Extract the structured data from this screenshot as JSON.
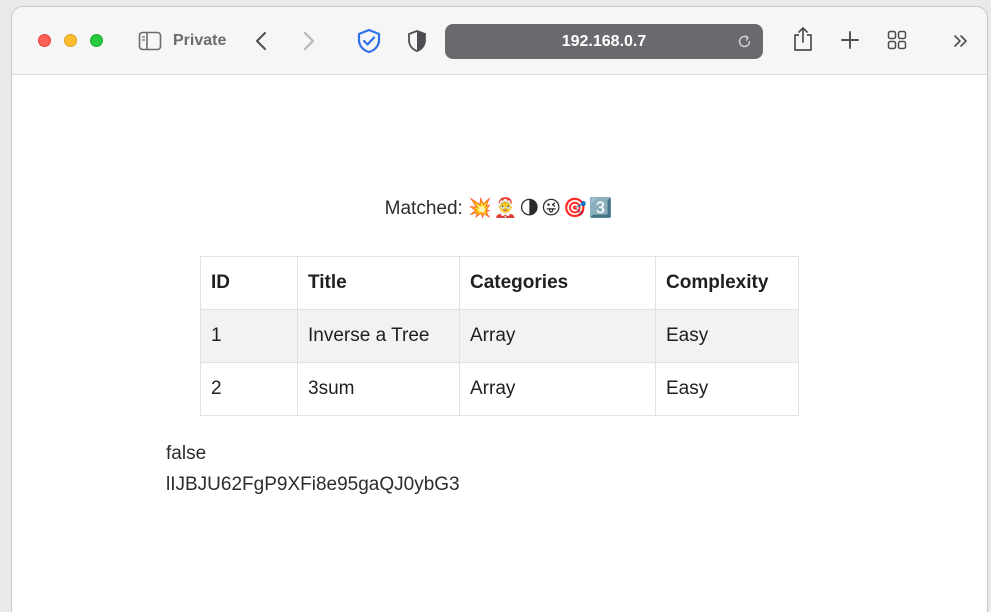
{
  "browser": {
    "private_label": "Private",
    "address": "192.168.0.7",
    "icons": [
      "sidebar-icon",
      "chevron-left-icon",
      "chevron-right-icon",
      "shield-check-icon",
      "privacy-shield-icon",
      "reload-icon",
      "share-icon",
      "plus-icon",
      "tab-grid-icon",
      "chevron-double-right-icon"
    ]
  },
  "page": {
    "matched_label": "Matched:",
    "matched_emojis": "💥🤶🌗😜🎯3️⃣",
    "table": {
      "headers": [
        "ID",
        "Title",
        "Categories",
        "Complexity"
      ],
      "rows": [
        [
          "1",
          "Inverse a Tree",
          "Array",
          "Easy"
        ],
        [
          "2",
          "3sum",
          "Array",
          "Easy"
        ]
      ]
    },
    "bool_value": "false",
    "token_value": "lIJBJU62FgP9XFi8e95gaQJ0ybG3"
  }
}
